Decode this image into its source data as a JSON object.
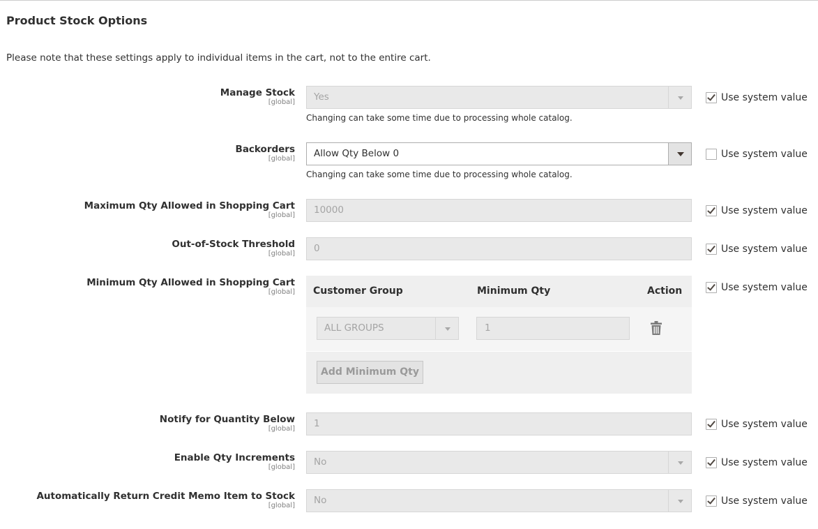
{
  "section": {
    "title": "Product Stock Options",
    "note": "Please note that these settings apply to individual items in the cart, not to the entire cart."
  },
  "scope_label": "[global]",
  "use_system_value_label": "Use system value",
  "fields": {
    "manage_stock": {
      "label": "Manage Stock",
      "value": "Yes",
      "note": "Changing can take some time due to processing whole catalog.",
      "use_system_value": true
    },
    "backorders": {
      "label": "Backorders",
      "value": "Allow Qty Below 0",
      "note": "Changing can take some time due to processing whole catalog.",
      "use_system_value": false
    },
    "max_qty": {
      "label": "Maximum Qty Allowed in Shopping Cart",
      "value": "10000",
      "use_system_value": true
    },
    "out_of_stock_threshold": {
      "label": "Out-of-Stock Threshold",
      "value": "0",
      "use_system_value": true
    },
    "min_qty": {
      "label": "Minimum Qty Allowed in Shopping Cart",
      "use_system_value": true,
      "table": {
        "col_group": "Customer Group",
        "col_qty": "Minimum Qty",
        "col_action": "Action",
        "rows": [
          {
            "group": "ALL GROUPS",
            "qty": "1"
          }
        ],
        "add_button": "Add Minimum Qty"
      }
    },
    "notify_qty_below": {
      "label": "Notify for Quantity Below",
      "value": "1",
      "use_system_value": true
    },
    "enable_qty_increments": {
      "label": "Enable Qty Increments",
      "value": "No",
      "use_system_value": true
    },
    "auto_return_credit_memo": {
      "label": "Automatically Return Credit Memo Item to Stock",
      "value": "No",
      "use_system_value": true
    }
  },
  "icons": {
    "select_arrow": "chevron-down-icon",
    "checkbox_check": "check-icon",
    "delete": "trash-icon"
  }
}
